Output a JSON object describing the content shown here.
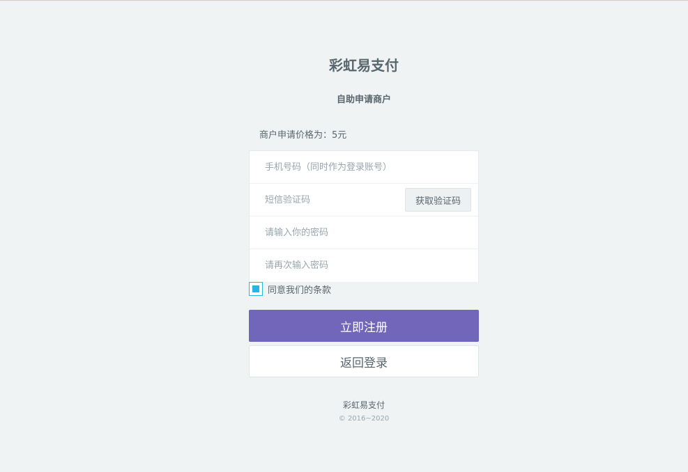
{
  "brand": {
    "title": "彩虹易支付"
  },
  "page": {
    "subtitle": "自助申请商户"
  },
  "price": {
    "text": "商户申请价格为：5元"
  },
  "form": {
    "phone_placeholder": "手机号码（同时作为登录账号）",
    "sms_placeholder": "短信验证码",
    "sms_button_label": "获取验证码",
    "password_placeholder": "请输入你的密码",
    "password_confirm_placeholder": "请再次输入密码",
    "agree_label": "同意我们的条款",
    "agree_checked": true
  },
  "actions": {
    "register_label": "立即注册",
    "back_login_label": "返回登录"
  },
  "footer": {
    "name": "彩虹易支付",
    "copyright": "© 2016~2020"
  },
  "colors": {
    "accent": "#7266ba",
    "checkbox": "#23b7e5",
    "background": "#eff3f4"
  }
}
